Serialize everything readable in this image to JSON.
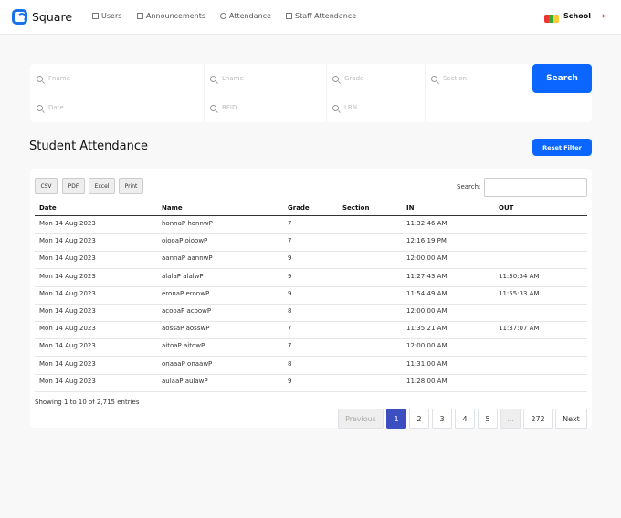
{
  "nav": {
    "brand": "Square",
    "items": [
      {
        "label": "Users",
        "icon": "grid-icon"
      },
      {
        "label": "Announcements",
        "icon": "calendar-icon"
      },
      {
        "label": "Attendance",
        "icon": "clock-icon"
      },
      {
        "label": "Staff Attendance",
        "icon": "check-square-icon"
      }
    ],
    "school": "School"
  },
  "filters": {
    "fname": "Fname",
    "lname": "Lname",
    "grade": "Grade",
    "section": "Section",
    "date": "Date",
    "rfid": "RFID",
    "lrn": "LRN",
    "search_button": "Search"
  },
  "page": {
    "title": "Student Attendance",
    "reset_button": "Reset Filter"
  },
  "export": {
    "csv": "CSV",
    "pdf": "PDF",
    "excel": "Excel",
    "print": "Print"
  },
  "search_label": "Search:",
  "table": {
    "headers": [
      "Date",
      "Name",
      "Grade",
      "Section",
      "IN",
      "OUT"
    ],
    "rows": [
      [
        "Mon 14 Aug 2023",
        "honnaP honnwP",
        "7",
        "",
        "11:32:46 AM",
        ""
      ],
      [
        "Mon 14 Aug 2023",
        "oiooaP oioowP",
        "7",
        "",
        "12:16:19 PM",
        ""
      ],
      [
        "Mon 14 Aug 2023",
        "aannaP aannwP",
        "9",
        "",
        "12:00:00 AM",
        ""
      ],
      [
        "Mon 14 Aug 2023",
        "alalaP alalwP",
        "9",
        "",
        "11:27:43 AM",
        "11:30:34 AM"
      ],
      [
        "Mon 14 Aug 2023",
        "eronaP eronwP",
        "9",
        "",
        "11:54:49 AM",
        "11:55:33 AM"
      ],
      [
        "Mon 14 Aug 2023",
        "acooaP acoowP",
        "8",
        "",
        "12:00:00 AM",
        ""
      ],
      [
        "Mon 14 Aug 2023",
        "aossaP aosswP",
        "7",
        "",
        "11:35:21 AM",
        "11:37:07 AM"
      ],
      [
        "Mon 14 Aug 2023",
        "aitoaP aitowP",
        "7",
        "",
        "12:00:00 AM",
        ""
      ],
      [
        "Mon 14 Aug 2023",
        "onaaaP onaawP",
        "8",
        "",
        "11:31:00 AM",
        ""
      ],
      [
        "Mon 14 Aug 2023",
        "aulaaP aulawP",
        "9",
        "",
        "11:28:00 AM",
        ""
      ]
    ]
  },
  "pagination": {
    "info": "Showing 1 to 10 of 2,715 entries",
    "previous": "Previous",
    "pages": [
      "1",
      "2",
      "3",
      "4",
      "5",
      "...",
      "272"
    ],
    "next": "Next",
    "current": "1"
  },
  "colors": {
    "accent": "#0a66ff",
    "active_page": "#3b4fc0"
  }
}
